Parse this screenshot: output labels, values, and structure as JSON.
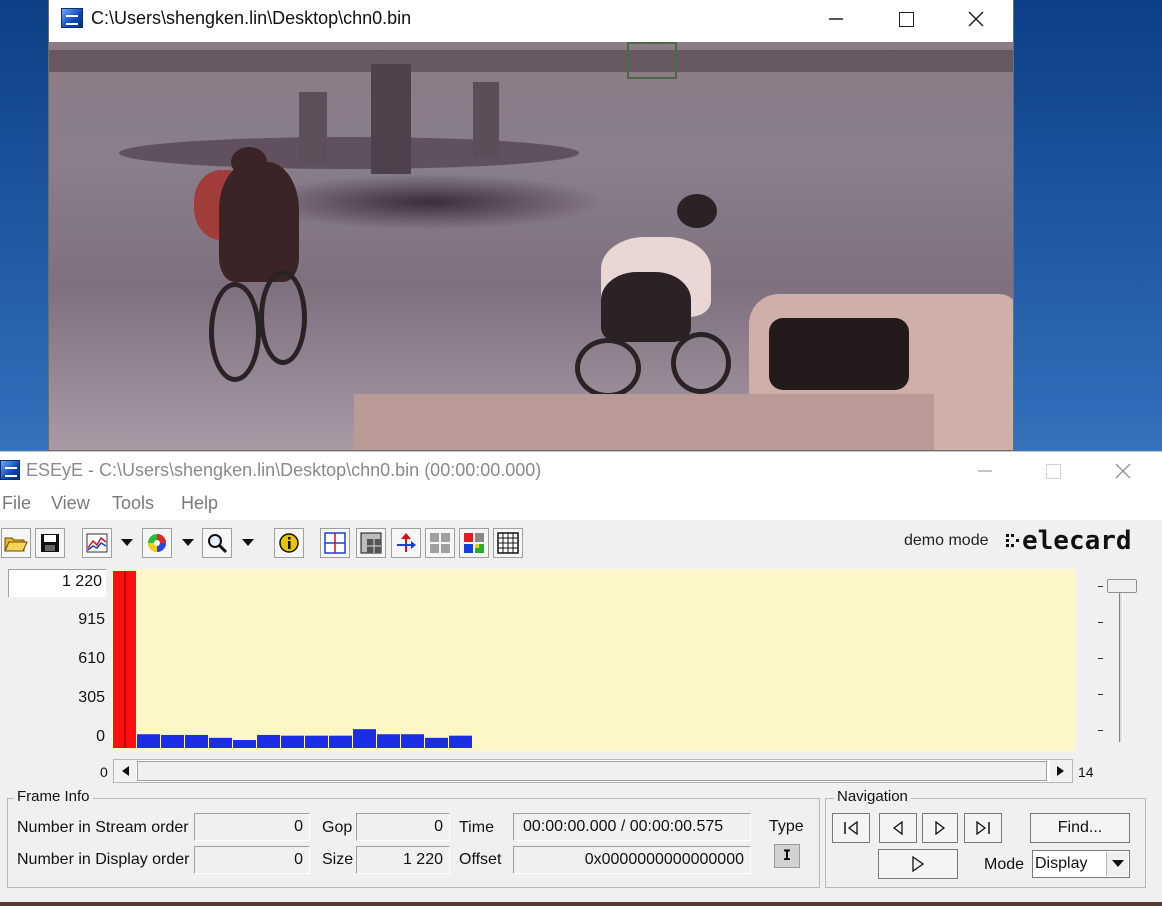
{
  "player": {
    "title": "C:\\Users\\shengken.lin\\Desktop\\chn0.bin"
  },
  "eseye": {
    "title": "ESEyE - C:\\Users\\shengken.lin\\Desktop\\chn0.bin (00:00:00.000)",
    "menu": [
      {
        "label": "File"
      },
      {
        "label": "View"
      },
      {
        "label": "Tools"
      },
      {
        "label": "Help"
      }
    ],
    "toolbar": {
      "icons": [
        "open-folder-icon",
        "save-disk-icon",
        "graph-icon",
        "color-wheel-icon",
        "zoom-icon",
        "info-icon",
        "grid-split-icon",
        "macroblock-icon",
        "motion-vector-icon",
        "blocks-gray-icon",
        "blocks-color-icon",
        "grid-icon"
      ],
      "demo_mode": "demo mode",
      "logo_text": "elecard"
    },
    "chart_data": {
      "type": "bar",
      "y_ticks": [
        "1 220",
        "915",
        "610",
        "305",
        "0"
      ],
      "ylim": [
        0,
        1220
      ],
      "x_min_label": "0",
      "x_max_label": "14",
      "values": [
        1220,
        95,
        90,
        90,
        70,
        55,
        90,
        85,
        85,
        85,
        130,
        95,
        95,
        70,
        85
      ],
      "colors": {
        "selected": "#ff1010",
        "bar": "#1b2ee6",
        "background": "#fdf7c8"
      },
      "selected_index": 0
    },
    "frame_info": {
      "group_label": "Frame Info",
      "stream_order_label": "Number in Stream order",
      "stream_order_value": "0",
      "display_order_label": "Number in Display order",
      "display_order_value": "0",
      "gop_label": "Gop",
      "gop_value": "0",
      "size_label": "Size",
      "size_value": "1 220",
      "time_label": "Time",
      "time_value": "00:00:00.000 / 00:00:00.575",
      "offset_label": "Offset",
      "offset_value": "0x0000000000000000",
      "type_label": "Type",
      "type_value": "I"
    },
    "navigation": {
      "group_label": "Navigation",
      "find_label": "Find...",
      "mode_label": "Mode",
      "mode_value": "Display"
    }
  }
}
